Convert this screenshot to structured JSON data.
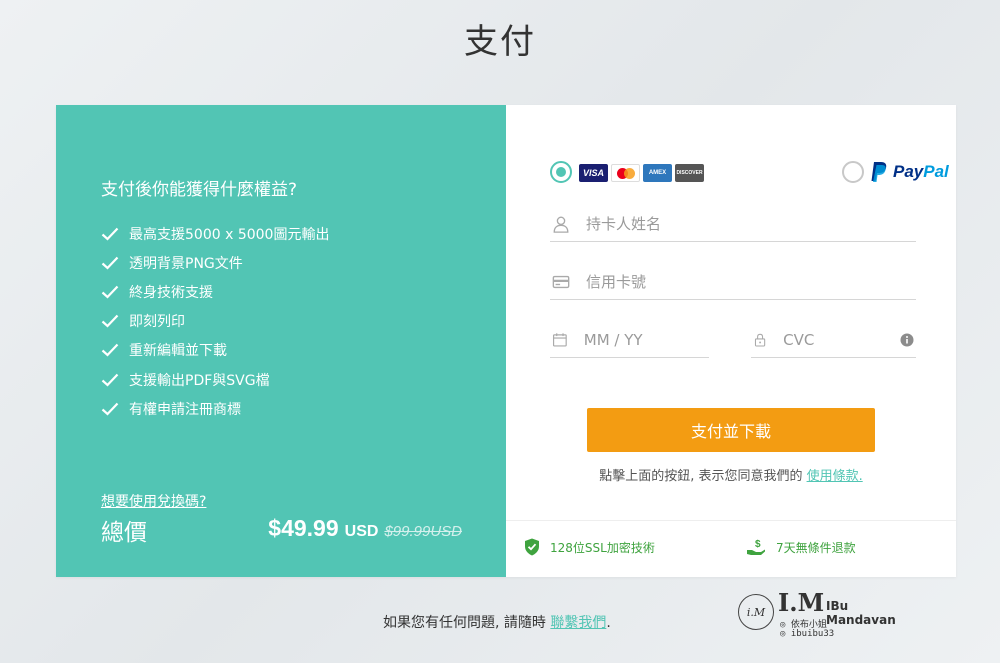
{
  "page": {
    "title": "支付"
  },
  "benefits": {
    "title": "支付後你能獲得什麼權益?",
    "items": [
      "最高支援5000 x 5000圖元輸出",
      "透明背景PNG文件",
      "終身技術支援",
      "即刻列印",
      "重新編輯並下載",
      "支援輸出PDF與SVG檔",
      "有權申請注冊商標"
    ],
    "coupon_link": "想要使用兌換碼?",
    "total_label": "總價",
    "price": "$49.99",
    "currency": "USD",
    "old_price": "$99.99USD"
  },
  "payment": {
    "card_brands": [
      "VISA",
      "mastercard",
      "AMERICAN EXPRESS",
      "DISCOVER"
    ],
    "paypal_pay": "Pay",
    "paypal_pal": "Pal",
    "name_placeholder": "持卡人姓名",
    "card_placeholder": "信用卡號",
    "expiry_placeholder": "MM / YY",
    "cvc_placeholder": "CVC",
    "pay_button": "支付並下載",
    "terms_text": "點擊上面的按鈕, 表示您同意我們的",
    "terms_link": "使用條款.",
    "ssl_badge": "128位SSL加密技術",
    "refund_badge": "7天無條件退款"
  },
  "footer": {
    "text": "如果您有任何問題, 請隨時",
    "link": "聯繫我們",
    "period": "."
  },
  "watermark": {
    "circle": "i.M",
    "brand": "I.M",
    "name": "IBu Mandavan",
    "line1": "依布小姐",
    "line2": "ibuibu33"
  },
  "colors": {
    "teal": "#52c5b4",
    "orange": "#f39c12",
    "green": "#3fa33f"
  }
}
